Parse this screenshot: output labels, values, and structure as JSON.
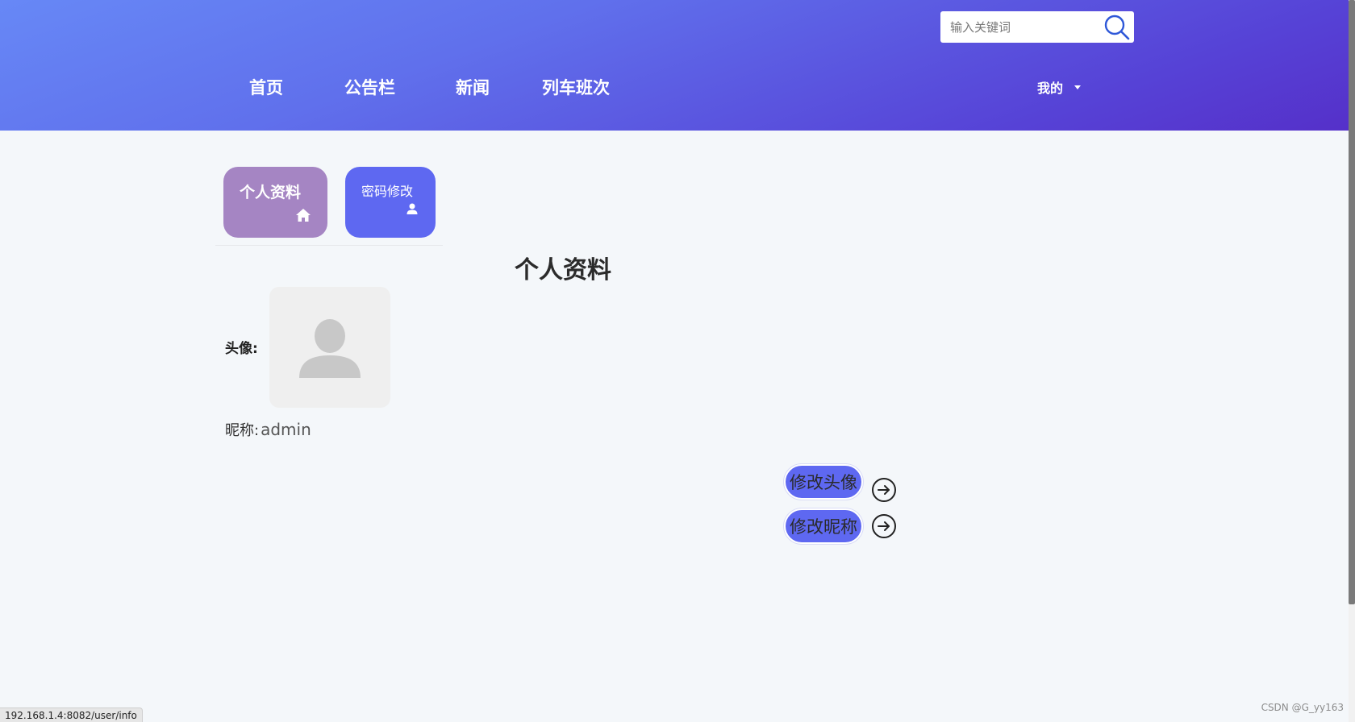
{
  "header": {
    "search": {
      "placeholder": "输入关键词"
    },
    "nav": [
      {
        "label": "首页"
      },
      {
        "label": "公告栏"
      },
      {
        "label": "新闻"
      },
      {
        "label": "列车班次"
      }
    ],
    "user_menu": {
      "label": "我的"
    }
  },
  "tabs": [
    {
      "label": "个人资料",
      "icon": "home-icon",
      "color": "#a585c3"
    },
    {
      "label": "密码修改",
      "icon": "user-icon",
      "color": "#5e68f1"
    }
  ],
  "main": {
    "title": "个人资料",
    "avatar_label": "头像:",
    "nickname_label": "昵称:",
    "nickname_value": "admin",
    "actions": [
      {
        "label": "修改头像"
      },
      {
        "label": "修改昵称"
      }
    ]
  },
  "status_bar": {
    "url": "192.168.1.4:8082/user/info"
  },
  "watermark": "CSDN @G_yy163",
  "colors": {
    "accent": "#5e68f1",
    "header_start": "#6788f6",
    "header_end": "#5530c9"
  }
}
